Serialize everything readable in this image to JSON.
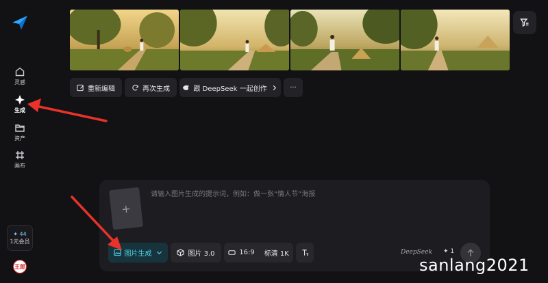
{
  "sidebar": {
    "items": [
      {
        "label": "灵感",
        "icon": "home-icon"
      },
      {
        "label": "生成",
        "icon": "sparkle-icon"
      },
      {
        "label": "资产",
        "icon": "folder-icon"
      },
      {
        "label": "画布",
        "icon": "canvas-icon"
      }
    ],
    "member": {
      "count": "✦ 44",
      "label": "1元会员"
    },
    "avatar_text": "王郎"
  },
  "images": [
    {
      "name": "generated-image-1",
      "content": "runner on rural path at sunset"
    },
    {
      "name": "generated-image-2",
      "content": "runner on rural path at sunset"
    },
    {
      "name": "generated-image-3",
      "content": "runner on rural path at sunset"
    },
    {
      "name": "generated-image-4",
      "content": "runner on rural path at sunset"
    }
  ],
  "actions": {
    "reedit": "重新编辑",
    "regenerate": "再次生成",
    "deepseek": "跟 DeepSeek 一起创作",
    "more": "···"
  },
  "composer": {
    "placeholder": "请输入图片生成的提示词，例如：做一张“情人节”海报",
    "mode": "图片生成",
    "model": "图片 3.0",
    "ratio": "16:9",
    "quality": "标清 1K",
    "deepseek_label": "DeepSeek",
    "credits": "✦ 1"
  },
  "watermark": "sanlang2021",
  "colors": {
    "accent": "#4fd4e8",
    "annotation_arrow": "#e8322a",
    "background": "#121214",
    "panel": "#1d1d21"
  }
}
